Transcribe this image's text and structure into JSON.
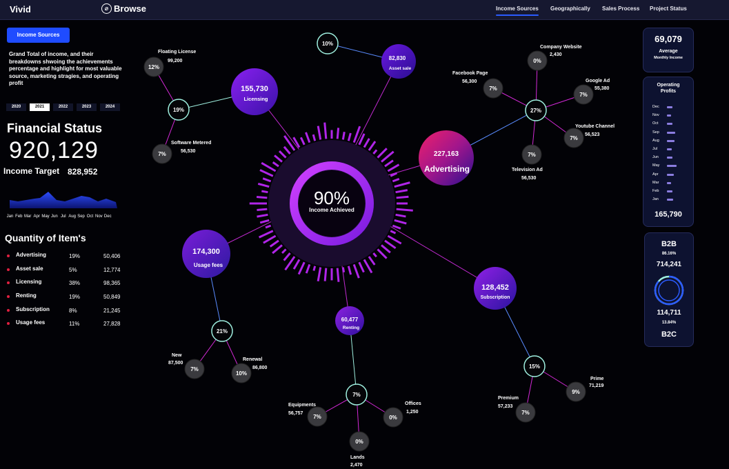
{
  "app": {
    "name": "Vivid",
    "browse_label": "Browse"
  },
  "nav": {
    "items": [
      "Income Sources",
      "Geographically",
      "Sales Process",
      "Project Status"
    ],
    "active": "Income Sources"
  },
  "left": {
    "button_label": "Income Sources",
    "intro": "Grand Total of income, and their breakdowns shwoing the achievements percentage and highlight for most valuable source, marketing stragies, and operating profit",
    "years": [
      "2020",
      "2021",
      "2022",
      "2023",
      "2024"
    ],
    "active_year": "2021",
    "financial_title": "Financial Status",
    "financial_value": "920,129",
    "target_label": "Income Target",
    "target_value": "828,952",
    "months": [
      "Jan",
      "Feb",
      "Mar",
      "Apr",
      "May",
      "Jun",
      "Jul",
      "Aug",
      "Sep",
      "Oct",
      "Nov",
      "Dec"
    ],
    "quantity_title": "Quantity of Item's",
    "quantity_items": [
      {
        "name": "Advertising",
        "pct": "19%",
        "value": "50,406"
      },
      {
        "name": "Asset sale",
        "pct": "5%",
        "value": "12,774"
      },
      {
        "name": "Licensing",
        "pct": "38%",
        "value": "98,365"
      },
      {
        "name": "Renting",
        "pct": "19%",
        "value": "50,849"
      },
      {
        "name": "Subscription",
        "pct": "8%",
        "value": "21,245"
      },
      {
        "name": "Usage fees",
        "pct": "11%",
        "value": "27,828"
      }
    ]
  },
  "center": {
    "percent": "90%",
    "label": "Income Achieved"
  },
  "sources": [
    {
      "value": "155,730",
      "name": "Licensing"
    },
    {
      "value": "82,830",
      "name": "Asset sale"
    },
    {
      "value": "227,163",
      "name": "Advertising"
    },
    {
      "value": "174,300",
      "name": "Usage fees"
    },
    {
      "value": "60,477",
      "name": "Renting"
    },
    {
      "value": "128,452",
      "name": "Subscription"
    }
  ],
  "hubs": [
    "19%",
    "10%",
    "27%",
    "21%",
    "7%",
    "15%"
  ],
  "leaves": [
    {
      "pct": "12%",
      "name": "Floating License",
      "value": "99,200"
    },
    {
      "pct": "7%",
      "name": "Software Metered",
      "value": "56,530"
    },
    {
      "pct": "0%",
      "name": "Company Website",
      "value": "2,430"
    },
    {
      "pct": "7%",
      "name": "Facebook Page",
      "value": "56,300"
    },
    {
      "pct": "7%",
      "name": "Google Ad",
      "value": "55,380"
    },
    {
      "pct": "7%",
      "name": "Youtube Channel",
      "value": "56,523"
    },
    {
      "pct": "7%",
      "name": "Television Ad",
      "value": "56,530"
    },
    {
      "pct": "7%",
      "name": "New",
      "value": "87,500"
    },
    {
      "pct": "10%",
      "name": "Renewal",
      "value": "86,800"
    },
    {
      "pct": "7%",
      "name": "Equipments",
      "value": "56,757"
    },
    {
      "pct": "0%",
      "name": "Offices",
      "value": "1,250"
    },
    {
      "pct": "0%",
      "name": "Lands",
      "value": "2,470"
    },
    {
      "pct": "7%",
      "name": "Premium",
      "value": "57,233"
    },
    {
      "pct": "9%",
      "name": "Prime",
      "value": "71,219"
    }
  ],
  "right": {
    "avg_value": "69,079",
    "avg_label": "Average",
    "avg_sublabel": "Monthly Income",
    "op_title": "Operating Profits",
    "op_months": [
      "Dec",
      "Nov",
      "Oct",
      "Sep",
      "Aug",
      "Jul",
      "Jun",
      "May",
      "Apr",
      "Mar",
      "Feb",
      "Jan"
    ],
    "op_levels": [
      0.55,
      0.4,
      0.6,
      0.85,
      0.75,
      0.5,
      0.55,
      1.0,
      0.7,
      0.45,
      0.6,
      0.65
    ],
    "op_total": "165,790",
    "b2b_label": "B2B",
    "b2b_pct": "86.16%",
    "b2b_value": "714,241",
    "b2c_value": "114,711",
    "b2c_pct": "13.84%",
    "b2c_label": "B2C",
    "b2b_share": 0.8616
  },
  "colors": {
    "accent": "#1f4cff",
    "purple": "#a01cf0",
    "teal": "#9ff0e0",
    "magenta": "#d42ad8",
    "pink": "#e0205a"
  }
}
